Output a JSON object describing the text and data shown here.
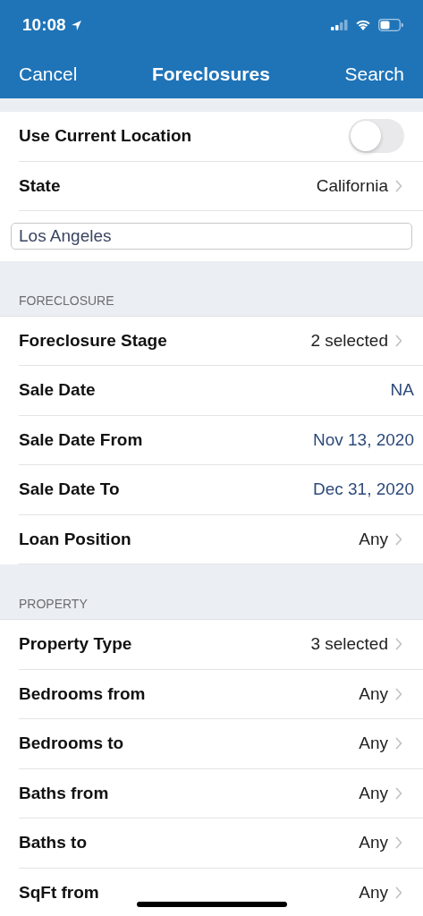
{
  "status_bar": {
    "time": "10:08"
  },
  "nav_bar": {
    "cancel": "Cancel",
    "title": "Foreclosures",
    "search": "Search"
  },
  "sections": [
    {
      "rows": [
        {
          "kind": "toggle",
          "label": "Use Current Location",
          "on": false
        },
        {
          "kind": "chevron",
          "label": "State",
          "value": "California"
        },
        {
          "kind": "field",
          "value": "Los Angeles"
        }
      ]
    },
    {
      "header": "FORECLOSURE",
      "rows": [
        {
          "kind": "chevron",
          "label": "Foreclosure Stage",
          "value": "2 selected"
        },
        {
          "kind": "date",
          "label": "Sale Date",
          "value": "NA"
        },
        {
          "kind": "date",
          "label": "Sale Date From",
          "value": "Nov 13, 2020"
        },
        {
          "kind": "date",
          "label": "Sale Date To",
          "value": "Dec 31, 2020"
        },
        {
          "kind": "chevron",
          "label": "Loan Position",
          "value": "Any"
        }
      ]
    },
    {
      "header": "PROPERTY",
      "rows": [
        {
          "kind": "chevron",
          "label": "Property Type",
          "value": "3 selected"
        },
        {
          "kind": "chevron",
          "label": "Bedrooms from",
          "value": "Any"
        },
        {
          "kind": "chevron",
          "label": "Bedrooms to",
          "value": "Any"
        },
        {
          "kind": "chevron",
          "label": "Baths from",
          "value": "Any"
        },
        {
          "kind": "chevron",
          "label": "Baths to",
          "value": "Any"
        },
        {
          "kind": "chevron",
          "label": "SqFt from",
          "value": "Any"
        }
      ]
    }
  ]
}
